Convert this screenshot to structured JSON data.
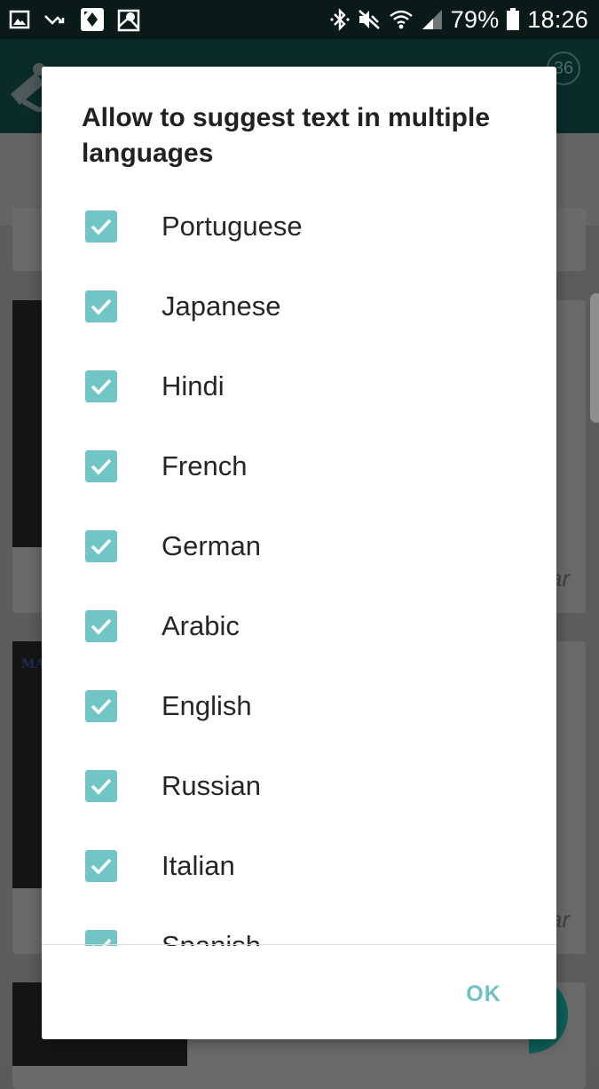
{
  "status_bar": {
    "battery_percent": "79%",
    "time": "18:26",
    "left_icons": [
      "gallery-icon",
      "missed-call-icon",
      "game-icon",
      "map-icon"
    ],
    "right_icons": [
      "bluetooth-icon",
      "mute-icon",
      "wifi-icon",
      "signal-icon",
      "battery-icon"
    ]
  },
  "background_app": {
    "badge_count": "36",
    "card_side_text": "ar",
    "card_corner_text": "MA"
  },
  "dialog": {
    "title": "Allow to suggest text in multiple languages",
    "languages": [
      {
        "label": "Portuguese",
        "checked": true
      },
      {
        "label": "Japanese",
        "checked": true
      },
      {
        "label": "Hindi",
        "checked": true
      },
      {
        "label": "French",
        "checked": true
      },
      {
        "label": "German",
        "checked": true
      },
      {
        "label": "Arabic",
        "checked": true
      },
      {
        "label": "English",
        "checked": true
      },
      {
        "label": "Russian",
        "checked": true
      },
      {
        "label": "Italian",
        "checked": true
      },
      {
        "label": "Spanish",
        "checked": true
      }
    ],
    "ok_label": "OK"
  },
  "colors": {
    "accent": "#71c5c4",
    "ok_text": "#6fc2c2",
    "status_bar": "#0a1a19",
    "app_bar": "#0a2b29",
    "dialog_background": "#ffffff",
    "text_primary": "#212121"
  }
}
